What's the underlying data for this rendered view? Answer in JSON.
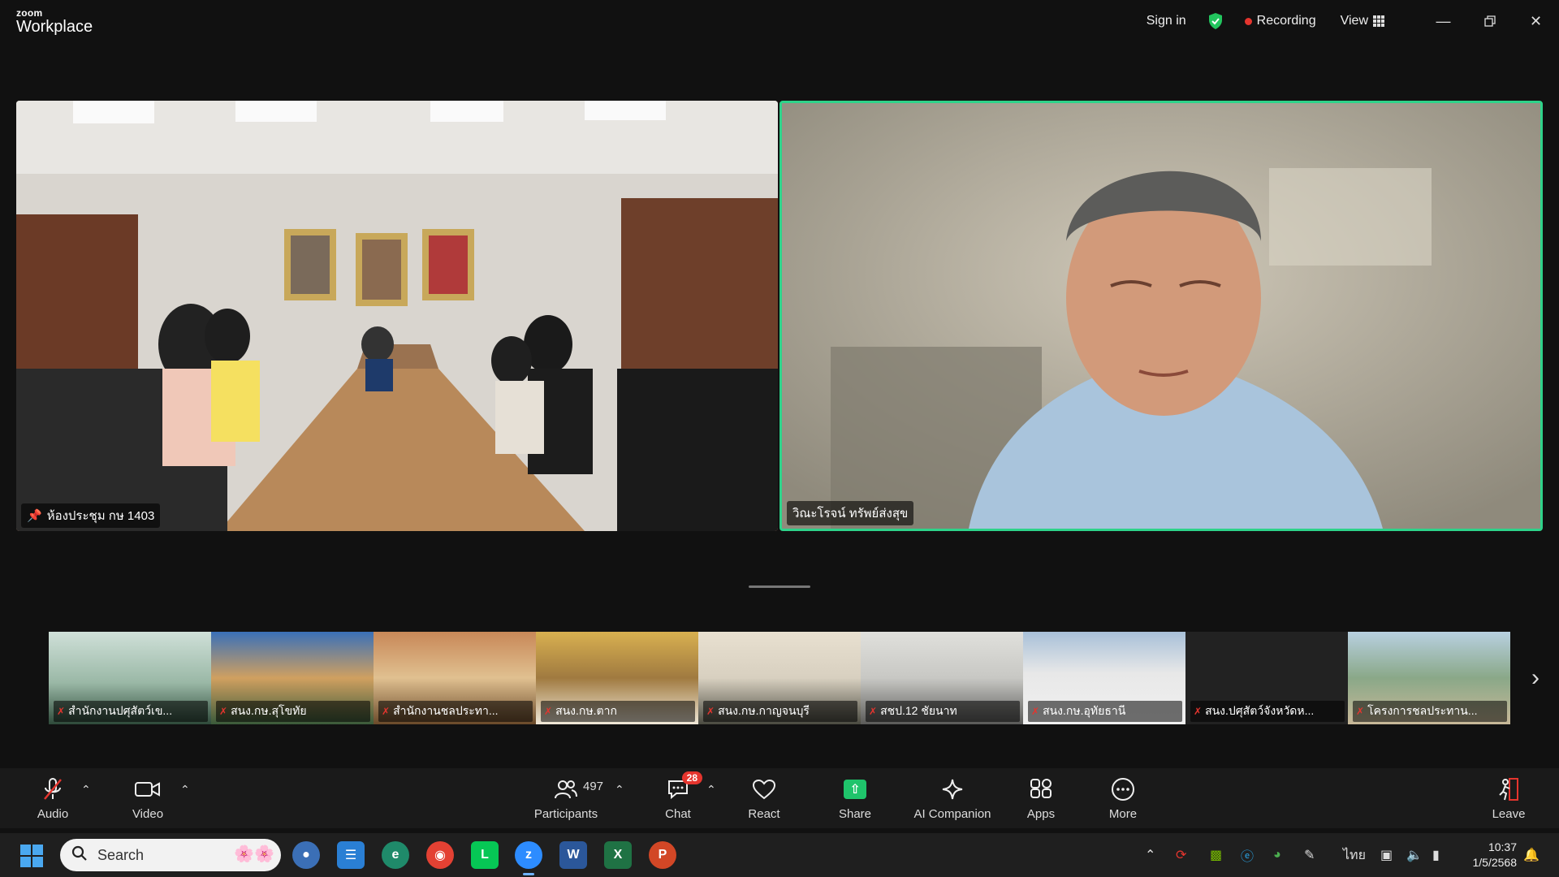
{
  "app": {
    "brand_small": "zoom",
    "brand_big": "Workplace"
  },
  "titlebar": {
    "sign_in": "Sign in",
    "recording": "Recording",
    "view": "View"
  },
  "tiles": [
    {
      "name": "ห้องประชุม กษ 1403",
      "pinned": true
    },
    {
      "name": "วิณะโรจน์ ทรัพย์ส่งสุข",
      "active_speaker": true
    }
  ],
  "thumbnails": [
    {
      "name": "สำนักงานปศุสัตว์เข...",
      "muted": true
    },
    {
      "name": "สนง.กษ.สุโขทัย",
      "muted": true
    },
    {
      "name": "สำนักงานชลประทา...",
      "muted": true
    },
    {
      "name": "สนง.กษ.ตาก",
      "muted": true
    },
    {
      "name": "สนง.กษ.กาญจนบุรี",
      "muted": true
    },
    {
      "name": "สชป.12 ชัยนาท",
      "muted": true
    },
    {
      "name": "สนง.กษ.อุทัยธานี",
      "muted": true
    },
    {
      "name": "สนง.ปศุสัตว์จังหวัดห...",
      "muted": true
    },
    {
      "name": "โครงการชลประทาน...",
      "muted": true
    }
  ],
  "toolbar": {
    "audio": "Audio",
    "video": "Video",
    "participants": "Participants",
    "participants_count": "497",
    "chat": "Chat",
    "chat_badge": "28",
    "react": "React",
    "share": "Share",
    "ai_companion": "AI Companion",
    "apps": "Apps",
    "more": "More",
    "leave": "Leave"
  },
  "taskbar": {
    "search_placeholder": "Search",
    "language": "ไทย",
    "time": "10:37",
    "date": "1/5/2568"
  },
  "colors": {
    "active_speaker_border": "#2ed38a",
    "recording_dot": "#e5352e",
    "share_green": "#1fc46b"
  }
}
